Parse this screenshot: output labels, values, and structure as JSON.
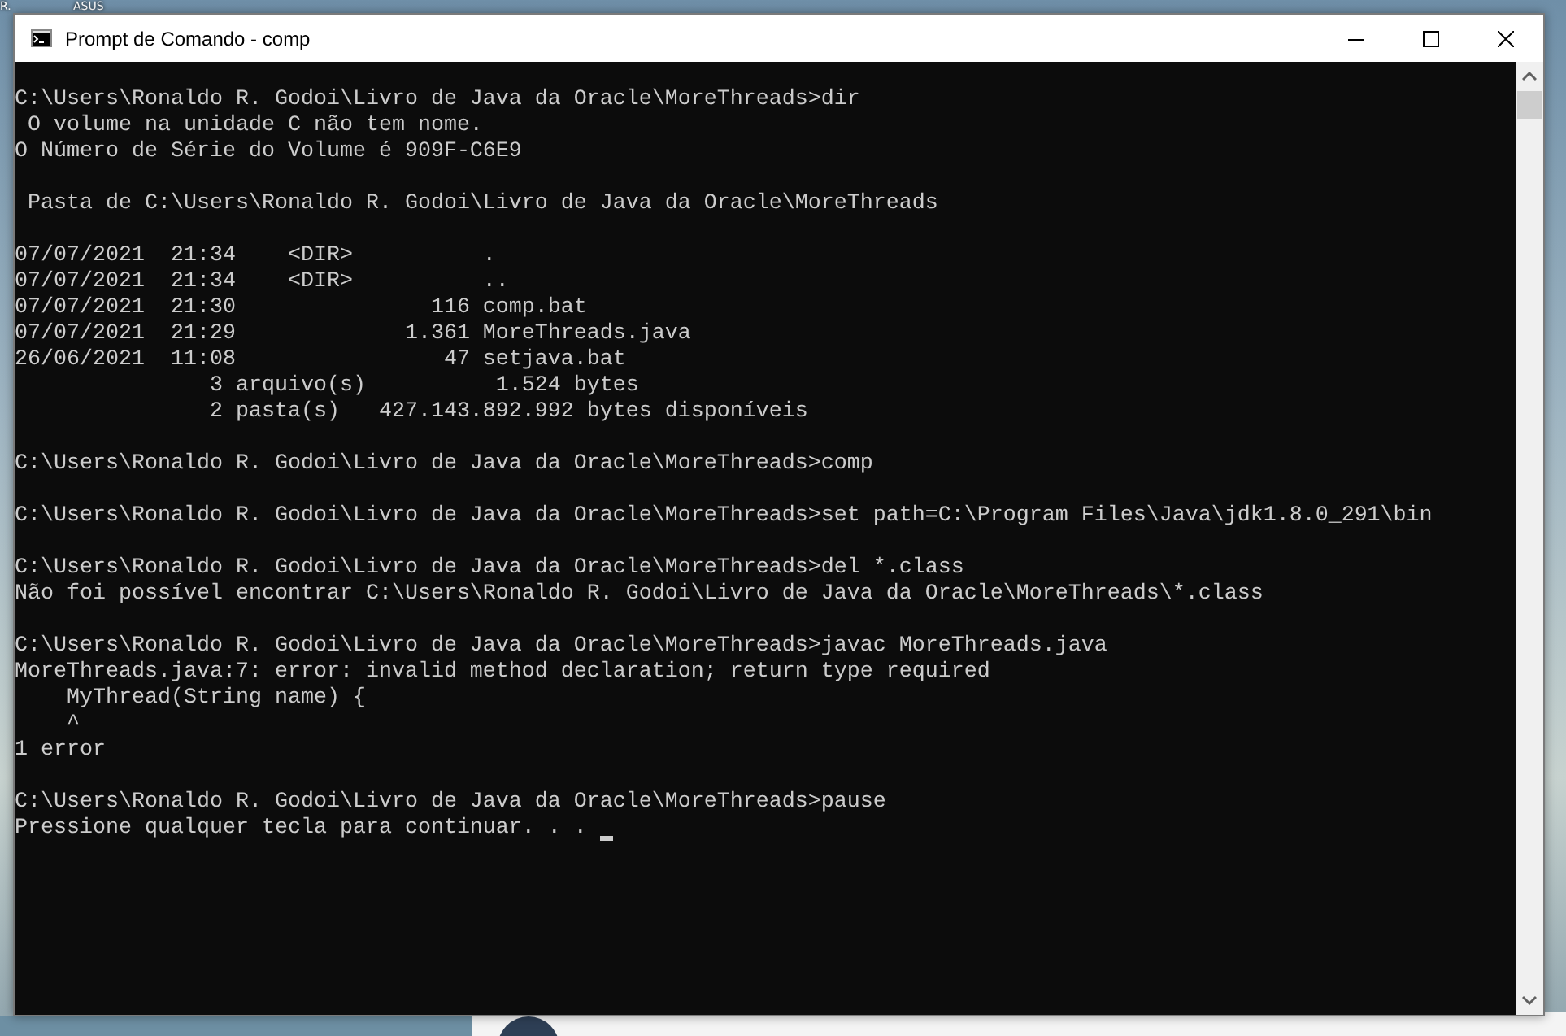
{
  "desktop": {
    "labels": [
      "R.",
      "ASUS"
    ]
  },
  "window": {
    "title": "Prompt de Comando - comp"
  },
  "console": {
    "blocks": [
      [
        "C:\\Users\\Ronaldo R. Godoi\\Livro de Java da Oracle\\MoreThreads>dir",
        " O volume na unidade C não tem nome.",
        "O Número de Série do Volume é 909F-C6E9"
      ],
      [
        " Pasta de C:\\Users\\Ronaldo R. Godoi\\Livro de Java da Oracle\\MoreThreads"
      ],
      [
        "07/07/2021  21:34    <DIR>          .",
        "07/07/2021  21:34    <DIR>          ..",
        "07/07/2021  21:30               116 comp.bat",
        "07/07/2021  21:29             1.361 MoreThreads.java",
        "26/06/2021  11:08                47 setjava.bat",
        "               3 arquivo(s)          1.524 bytes",
        "               2 pasta(s)   427.143.892.992 bytes disponíveis"
      ],
      [
        "C:\\Users\\Ronaldo R. Godoi\\Livro de Java da Oracle\\MoreThreads>comp"
      ],
      [
        "C:\\Users\\Ronaldo R. Godoi\\Livro de Java da Oracle\\MoreThreads>set path=C:\\Program Files\\Java\\jdk1.8.0_291\\bin"
      ],
      [
        "C:\\Users\\Ronaldo R. Godoi\\Livro de Java da Oracle\\MoreThreads>del *.class",
        "Não foi possível encontrar C:\\Users\\Ronaldo R. Godoi\\Livro de Java da Oracle\\MoreThreads\\*.class"
      ],
      [
        "C:\\Users\\Ronaldo R. Godoi\\Livro de Java da Oracle\\MoreThreads>javac MoreThreads.java",
        "MoreThreads.java:7: error: invalid method declaration; return type required",
        "    MyThread(String name) {",
        "    ^",
        "1 error"
      ],
      [
        "C:\\Users\\Ronaldo R. Godoi\\Livro de Java da Oracle\\MoreThreads>pause",
        "Pressione qualquer tecla para continuar. . . "
      ]
    ]
  }
}
